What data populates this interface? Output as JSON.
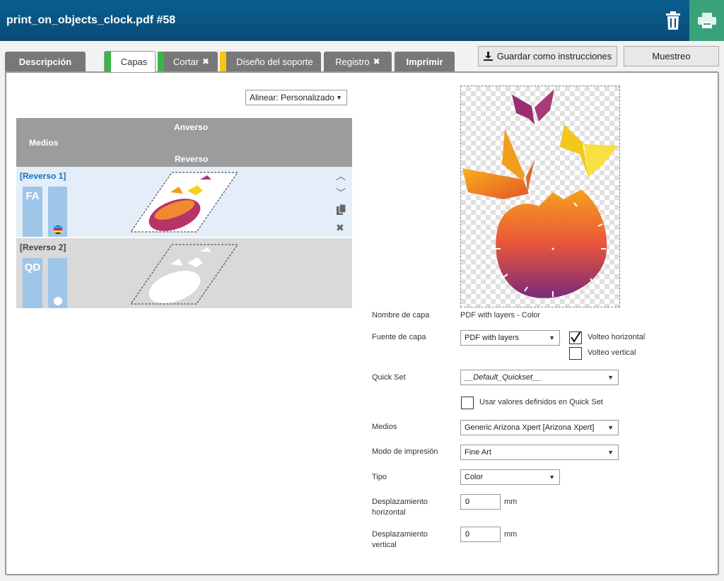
{
  "window": {
    "title": "print_on_objects_clock.pdf #58"
  },
  "tabs": [
    {
      "label": "Descripción",
      "stripe": null,
      "x": false
    },
    {
      "label": "Capas",
      "stripe": "#3bb54a",
      "x": false,
      "active": true
    },
    {
      "label": "Cortar",
      "stripe": "#3bb54a",
      "x": true
    },
    {
      "label": "Diseño del soporte",
      "stripe": "#f5c518",
      "x": false
    },
    {
      "label": "Registro",
      "stripe": null,
      "x": true
    },
    {
      "label": "Imprimir",
      "stripe": null,
      "x": false
    }
  ],
  "toolbar": {
    "save_instructions": "Guardar como instrucciones",
    "sample": "Muestreo"
  },
  "align": {
    "value": "Alinear: Personalizado"
  },
  "table": {
    "medios": "Medios",
    "anverso": "Anverso",
    "reverso": "Reverso",
    "rows": [
      {
        "label": "[Reverso 1]",
        "badge": "FA"
      },
      {
        "label": "[Reverso 2]",
        "badge": "QD"
      }
    ]
  },
  "form": {
    "layer_name_label": "Nombre de capa",
    "layer_name_value": "PDF with layers - Color",
    "layer_source_label": "Fuente de capa",
    "layer_source_value": "PDF with layers",
    "flip_h_label": "Volteo horizontal",
    "flip_h_checked": true,
    "flip_v_label": "Volteo vertical",
    "flip_v_checked": false,
    "quickset_label": "Quick Set",
    "quickset_value": "__Default_Quickset__",
    "use_quickset_label": "Usar valores definidos en Quick Set",
    "media_label": "Medios",
    "media_value": "Generic Arizona Xpert [Arizona Xpert]",
    "print_mode_label": "Modo de impresión",
    "print_mode_value": "Fine Art",
    "type_label": "Tipo",
    "type_value": "Color",
    "h_offset_label_1": "Desplazamiento",
    "h_offset_label_2": "horizontal",
    "h_offset_value": "0",
    "v_offset_label_1": "Desplazamiento",
    "v_offset_label_2": "vertical",
    "v_offset_value": "0",
    "unit": "mm"
  },
  "colors": {
    "header": "#0a4a78",
    "print": "#3aa27a",
    "active_row": "#e3eef8",
    "inactive_row": "#d9d9d9",
    "link_blue": "#1a6fc0"
  }
}
